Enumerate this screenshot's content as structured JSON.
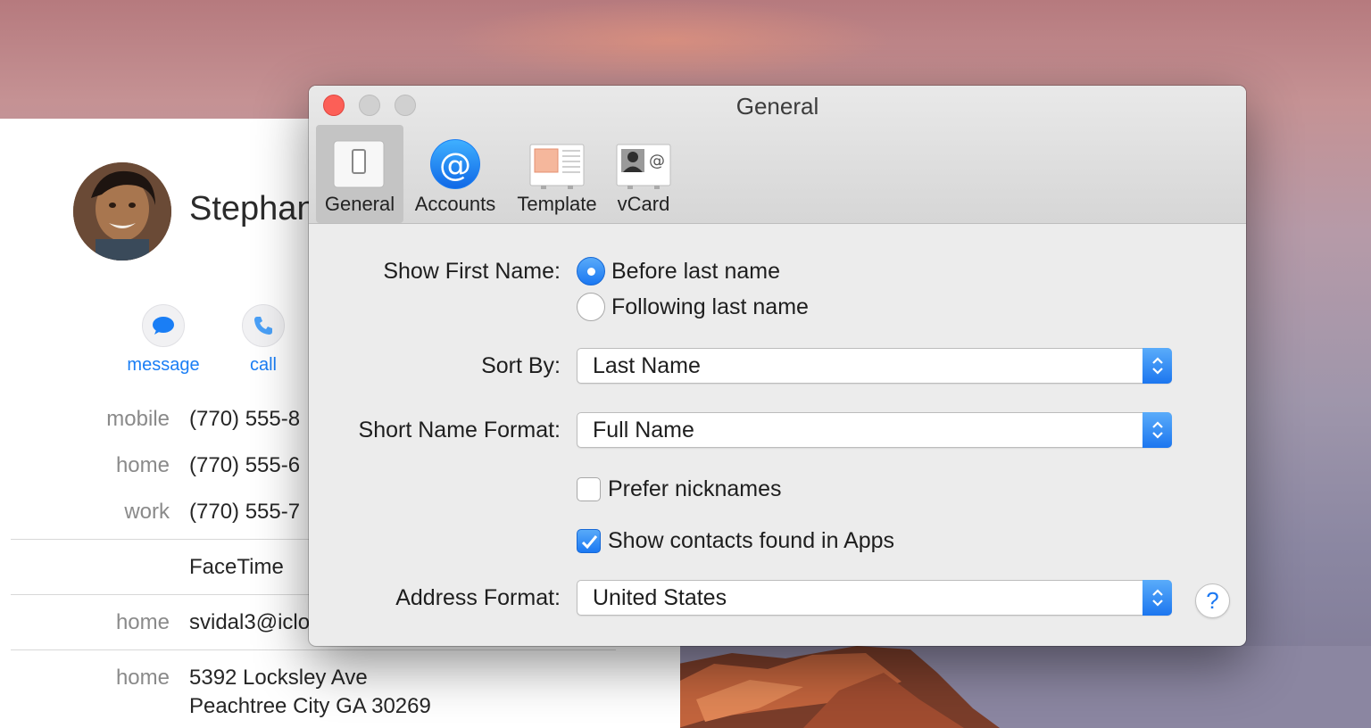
{
  "contact": {
    "name": "Stephan",
    "actions": [
      {
        "label": "message",
        "icon": "speech-bubble-icon"
      },
      {
        "label": "call",
        "icon": "phone-icon"
      }
    ],
    "phones": [
      {
        "key": "mobile",
        "value": "(770) 555-8"
      },
      {
        "key": "home",
        "value": "(770) 555-6"
      },
      {
        "key": "work",
        "value": "(770) 555-7"
      }
    ],
    "facetime": "FaceTime",
    "email": {
      "key": "home",
      "value": "svidal3@iclo"
    },
    "address": {
      "key": "home",
      "line1": "5392 Locksley Ave",
      "line2": "Peachtree City GA 30269"
    }
  },
  "dialog": {
    "title": "General",
    "toolbar": [
      {
        "label": "General",
        "icon": "switch-icon",
        "active": true
      },
      {
        "label": "Accounts",
        "icon": "at-sign-icon",
        "active": false
      },
      {
        "label": "Template",
        "icon": "template-card-icon",
        "active": false
      },
      {
        "label": "vCard",
        "icon": "vcard-icon",
        "active": false
      }
    ],
    "show_first_name": {
      "label": "Show First Name:",
      "options": [
        "Before last name",
        "Following last name"
      ],
      "selected": "Before last name"
    },
    "sort_by": {
      "label": "Sort By:",
      "value": "Last Name"
    },
    "short_name_format": {
      "label": "Short Name Format:",
      "value": "Full Name"
    },
    "prefer_nicknames": {
      "label": "Prefer nicknames",
      "checked": false
    },
    "show_contacts_found": {
      "label": "Show contacts found in Apps",
      "checked": true
    },
    "address_format": {
      "label": "Address Format:",
      "value": "United States"
    },
    "help": "?"
  },
  "colors": {
    "accent": "#1b78f2",
    "close": "#fc5f57",
    "link": "#1a7ef5"
  }
}
